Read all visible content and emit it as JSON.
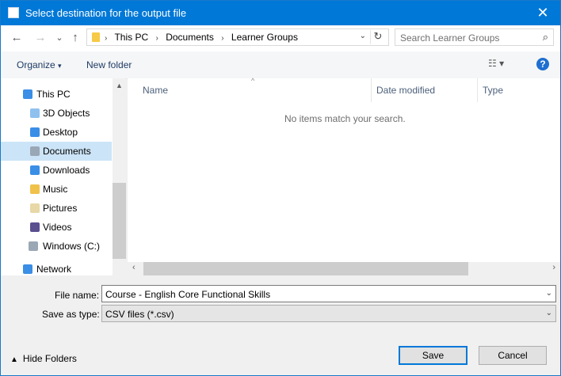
{
  "window": {
    "title": "Select destination for the output file"
  },
  "nav_buttons": {
    "back": "←",
    "forward": "→",
    "recent": "⌄",
    "up": "↑"
  },
  "address": {
    "crumbs": [
      "This PC",
      "Documents",
      "Learner Groups"
    ],
    "separator": "›"
  },
  "search": {
    "placeholder": "Search Learner Groups"
  },
  "toolbar": {
    "organize": "Organize",
    "organize_arrow": "▾",
    "new_folder": "New folder",
    "view_icon": "☷ ▾",
    "help": "?"
  },
  "sidebar": {
    "items": [
      {
        "label": "This PC",
        "icon": "computer-icon"
      },
      {
        "label": "3D Objects",
        "icon": "folder-3d-icon"
      },
      {
        "label": "Desktop",
        "icon": "desktop-folder-icon"
      },
      {
        "label": "Documents",
        "icon": "documents-folder-icon",
        "selected": true
      },
      {
        "label": "Downloads",
        "icon": "downloads-folder-icon"
      },
      {
        "label": "Music",
        "icon": "music-folder-icon"
      },
      {
        "label": "Pictures",
        "icon": "pictures-folder-icon"
      },
      {
        "label": "Videos",
        "icon": "videos-folder-icon"
      },
      {
        "label": "Windows (C:)",
        "icon": "drive-icon"
      },
      {
        "label": "Network",
        "icon": "network-icon"
      }
    ]
  },
  "list": {
    "columns": [
      "Name",
      "Date modified",
      "Type"
    ],
    "empty_message": "No items match your search."
  },
  "form": {
    "file_name_label": "File name:",
    "file_name_value": "Course - English Core Functional Skills",
    "save_type_label": "Save as type:",
    "save_type_value": "CSV files (*.csv)"
  },
  "footer": {
    "hide_folders": "Hide Folders",
    "save": "Save",
    "cancel": "Cancel"
  },
  "colors": {
    "titlebar": "#0078d7",
    "selection": "#cce4f7",
    "link": "#1e3b66"
  }
}
